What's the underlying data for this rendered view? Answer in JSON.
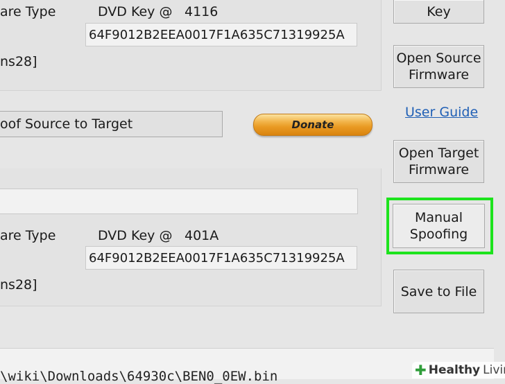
{
  "source_panel": {
    "hardware_type_label": "are Type",
    "dvd_key_label": "DVD Key @",
    "dvd_key_offset": "4116",
    "key_value": "64F9012B2EEA0017F1A635C71319925A",
    "model_fragment": "ns28]"
  },
  "spoof_button": "oof Source to Target",
  "donate_label": "Donate",
  "target_panel": {
    "firmware_field_value": "",
    "hardware_type_label": "are Type",
    "dvd_key_label": "DVD Key @",
    "dvd_key_offset": "401A",
    "key_value": "64F9012B2EEA0017F1A635C71319925A",
    "model_fragment": "ns28]"
  },
  "right_buttons": {
    "key": "Key",
    "open_source_firmware_line1": "Open Source",
    "open_source_firmware_line2": "Firmware",
    "user_guide": "User Guide",
    "open_target_firmware_line1": "Open Target",
    "open_target_firmware_line2": "Firmware",
    "manual_spoofing_line1": "Manual",
    "manual_spoofing_line2": "Spoofing",
    "save_to_file": "Save to File"
  },
  "status_path": "\\wiki\\Downloads\\64930c\\BEN0_0EW.bin",
  "watermark": {
    "brand": "Healthy",
    "suffix": "Living"
  },
  "colors": {
    "highlight": "#1de31d",
    "link": "#1f5fb5",
    "donate": "#e99a23"
  }
}
